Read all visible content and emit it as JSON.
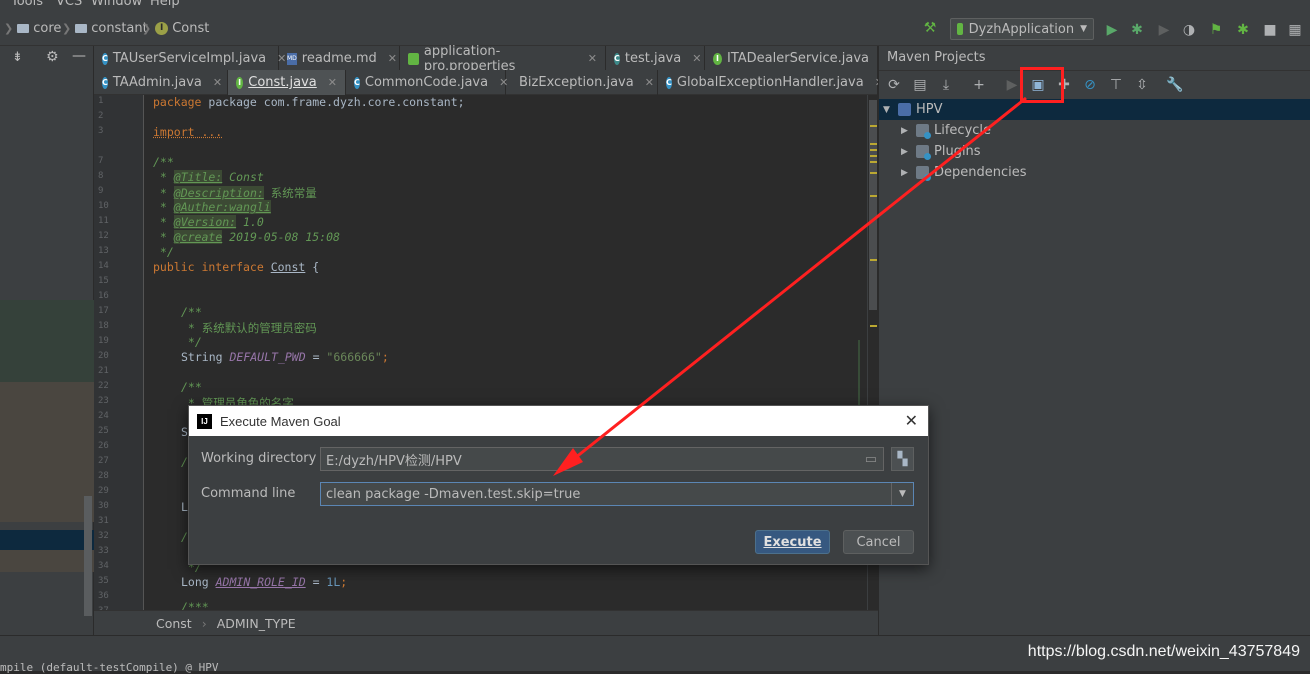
{
  "menu": [
    "Tools",
    "VCS",
    "Window",
    "Help"
  ],
  "nav": {
    "crumbs": [
      "core",
      "constant",
      "Const"
    ],
    "run_config": "DyzhApplication"
  },
  "tabs_row1": [
    {
      "label": "TAUserServiceImpl.java",
      "icon": "class"
    },
    {
      "label": "readme.md",
      "icon": "md"
    },
    {
      "label": "application-pro.properties",
      "icon": "properties"
    },
    {
      "label": "test.java",
      "icon": "class"
    },
    {
      "label": "ITADealerService.java",
      "icon": "interface"
    }
  ],
  "tabs_row2": [
    {
      "label": "TAAdmin.java",
      "icon": "class"
    },
    {
      "label": "Const.java",
      "icon": "interface",
      "active": true
    },
    {
      "label": "CommonCode.java",
      "icon": "class"
    },
    {
      "label": "BizException.java",
      "icon": "exception"
    },
    {
      "label": "GlobalExceptionHandler.java",
      "icon": "class"
    }
  ],
  "line_numbers": [
    "1",
    "2",
    "3",
    "7",
    "8",
    "9",
    "10",
    "11",
    "12",
    "13",
    "14",
    "15",
    "16",
    "17",
    "18",
    "19",
    "20",
    "21",
    "22",
    "23",
    "24",
    "25",
    "26",
    "27",
    "28",
    "29",
    "30",
    "31",
    "32",
    "33",
    "34",
    "35",
    "36",
    "37"
  ],
  "code": {
    "l1": "package com.frame.dyzh.core.constant;",
    "l3": "import ...",
    "l8": "/**",
    "l9_tag": "@Title:",
    "l9_val": " Const",
    "l10_tag": "@Description:",
    "l10_val": " 系统常量",
    "l11_tag": "@Auther:wangli",
    "l12_tag": "@Version:",
    "l12_val": " 1.0",
    "l13_tag": "@create",
    "l13_val": " 2019-05-08 15:08",
    "l14": " */",
    "l15_kw": "public interface ",
    "l15_name": "Const",
    "l15_end": " {",
    "l18": "/**",
    "l19": " * 系统默认的管理员密码",
    "l20": " */",
    "l21_type": "String ",
    "l21_const": "DEFAULT_PWD",
    "l21_eq": " = ",
    "l21_str": "\"666666\"",
    "l21_end": ";",
    "l23": "/**",
    "l24": " * 管理员角色的名字",
    "l26": "S",
    "l28": "/",
    "l31": "L",
    "l33": "/",
    "l35": " */",
    "l36_type": "Long ",
    "l36_const": "ADMIN_ROLE_ID",
    "l36_eq": " = ",
    "l36_num": "1L",
    "l36_end": ";",
    "l37": "/***"
  },
  "editor_breadcrumb": [
    "Const",
    "ADMIN_TYPE"
  ],
  "maven": {
    "title": "Maven Projects",
    "root": "HPV",
    "children": [
      "Lifecycle",
      "Plugins",
      "Dependencies"
    ]
  },
  "dialog": {
    "title": "Execute Maven Goal",
    "working_dir_label": "Working directory",
    "working_dir_value": "E:/dyzh/HPV检测/HPV",
    "command_label": "Command line",
    "command_value": "clean package  -Dmaven.test.skip=true",
    "execute": "Execute",
    "cancel": "Cancel"
  },
  "console": "mpile (default-testCompile) @ HPV",
  "watermark": "https://blog.csdn.net/weixin_43757849",
  "colors": {
    "annotation": "#ff2020",
    "accent": "#365880",
    "background": "#2b2b2b"
  }
}
